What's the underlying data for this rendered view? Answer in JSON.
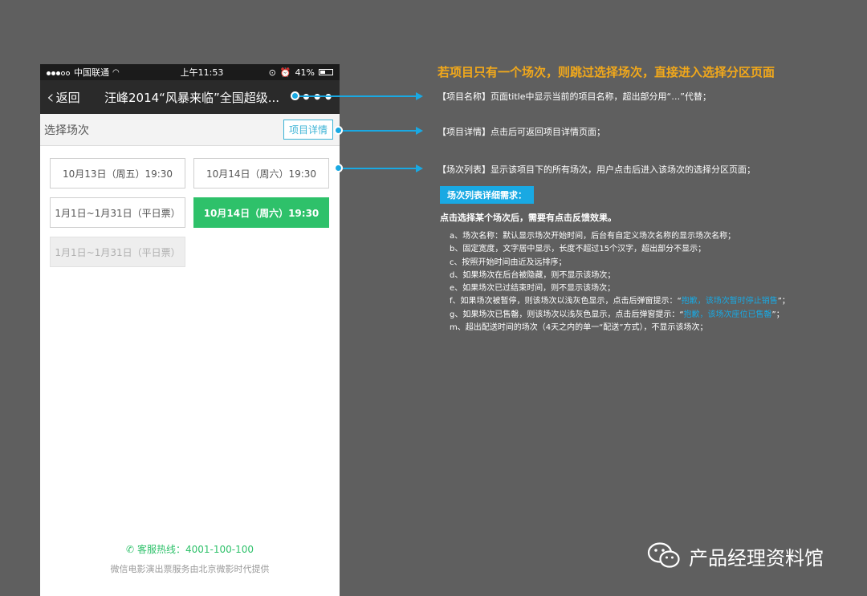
{
  "status_bar": {
    "carrier": "中国联通",
    "time": "上午11:53",
    "battery": "41%",
    "battery_level": 0.41
  },
  "nav": {
    "back_label": "返回",
    "title": "汪峰2014“风暴来临”全国超级..."
  },
  "subheader": {
    "title": "选择场次",
    "detail_button": "项目详情"
  },
  "sessions": [
    {
      "label": "10月13日（周五）19:30",
      "state": "normal"
    },
    {
      "label": "10月14日（周六）19:30",
      "state": "normal"
    },
    {
      "label": "1月1日~1月31日（平日票）",
      "state": "normal"
    },
    {
      "label": "10月14日（周六）19:30",
      "state": "selected"
    },
    {
      "label": "1月1日~1月31日（平日票）",
      "state": "disabled"
    }
  ],
  "footer": {
    "hotline": "客服热线：4001-100-100",
    "provider": "微信电影演出票服务由北京微影时代提供"
  },
  "annotations": {
    "headline": "若项目只有一个场次，则跳过选择场次，直接进入选择分区页面",
    "note_name": "【项目名称】页面title中显示当前的项目名称，超出部分用“…”代替；",
    "note_detail": "【项目详情】点击后可返回项目详情页面；",
    "note_list": "【场次列表】显示该项目下的所有场次，用户点击后进入该场次的选择分区页面；",
    "list_tag": "场次列表详细需求：",
    "list_sub": "点击选择某个场次后，需要有点击反馈效果。",
    "rules": {
      "a": "a、场次名称：默认显示场次开始时间，后台有自定义场次名称的显示场次名称；",
      "b": "b、固定宽度，文字居中显示，长度不超过15个汉字，超出部分不显示；",
      "c": "c、按照开始时间由近及远排序；",
      "d": "d、如果场次在后台被隐藏，则不显示该场次；",
      "e": "e、如果场次已过结束时间，则不显示该场次；",
      "f_prefix": "f、如果场次被暂停，则该场次以浅灰色显示，点击后弹窗提示：“",
      "f_highlight": "抱歉，该场次暂时停止销售",
      "f_suffix": "”；",
      "g_prefix": "g、如果场次已售罄，则该场次以浅灰色显示，点击后弹窗提示：“",
      "g_highlight": "抱歉，该场次座位已售罄",
      "g_suffix": "”；",
      "m": "m、超出配送时间的场次（4天之内的单一“配送”方式），不显示该场次；"
    }
  },
  "watermark": "产品经理资料馆",
  "colors": {
    "background": "#5f5f5f",
    "accent_blue": "#19a9e3",
    "selected_green": "#2ec16a",
    "headline_orange": "#f1a81b"
  }
}
